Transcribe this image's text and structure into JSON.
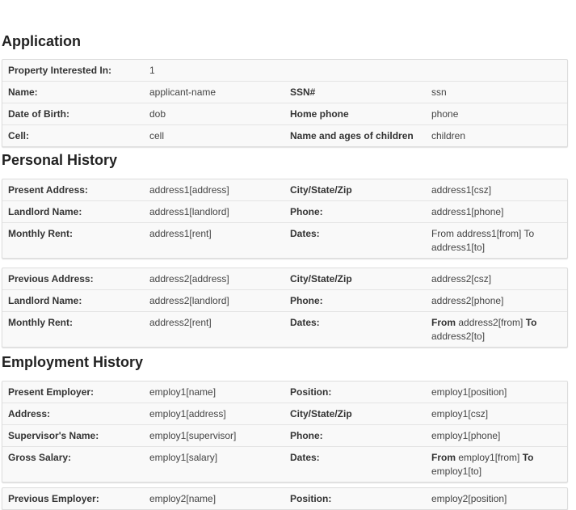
{
  "sections": {
    "application": {
      "title": "Application",
      "rows": [
        {
          "l1": "Property Interested In:",
          "v1": "1"
        },
        {
          "l1": "Name:",
          "v1": "applicant-name",
          "l2": "SSN#",
          "v2": "ssn"
        },
        {
          "l1": "Date of Birth:",
          "v1": "dob",
          "l2": "Home phone",
          "v2": "phone"
        },
        {
          "l1": "Cell:",
          "v1": "cell",
          "l2": "Name and ages of children",
          "v2": "children"
        }
      ]
    },
    "personal": {
      "title": "Personal History",
      "present": [
        {
          "l1": "Present Address:",
          "v1": "address1[address]",
          "l2": "City/State/Zip",
          "v2": "address1[csz]"
        },
        {
          "l1": "Landlord Name:",
          "v1": "address1[landlord]",
          "l2": "Phone:",
          "v2": "address1[phone]"
        },
        {
          "l1": "Monthly Rent:",
          "v1": "address1[rent]",
          "l2": "Dates:",
          "v2": "From address1[from] To address1[to]"
        }
      ],
      "previous": [
        {
          "l1": "Previous Address:",
          "v1": "address2[address]",
          "l2": "City/State/Zip",
          "v2": "address2[csz]"
        },
        {
          "l1": "Landlord Name:",
          "v1": "address2[landlord]",
          "l2": "Phone:",
          "v2": "address2[phone]"
        },
        {
          "l1": "Monthly Rent:",
          "v1": "address2[rent]",
          "l2": "Dates:",
          "from_word": "From",
          "from_value": "address2[from]",
          "to_word": "To",
          "to_value": "address2[to]"
        }
      ]
    },
    "employment": {
      "title": "Employment History",
      "present": [
        {
          "l1": "Present Employer:",
          "v1": "employ1[name]",
          "l2": "Position:",
          "v2": "employ1[position]"
        },
        {
          "l1": "Address:",
          "v1": "employ1[address]",
          "l2": "City/State/Zip",
          "v2": "employ1[csz]"
        },
        {
          "l1": "Supervisor's Name:",
          "v1": "employ1[supervisor]",
          "l2": "Phone:",
          "v2": "employ1[phone]"
        },
        {
          "l1": "Gross Salary:",
          "v1": "employ1[salary]",
          "l2": "Dates:",
          "from_word": "From",
          "from_value": "employ1[from]",
          "to_word": "To",
          "to_value": "employ1[to]"
        }
      ],
      "previous_partial": {
        "l1": "Previous Employer:",
        "v1": "employ2[name]",
        "l2": "Position:",
        "v2": "employ2[position]"
      }
    }
  }
}
